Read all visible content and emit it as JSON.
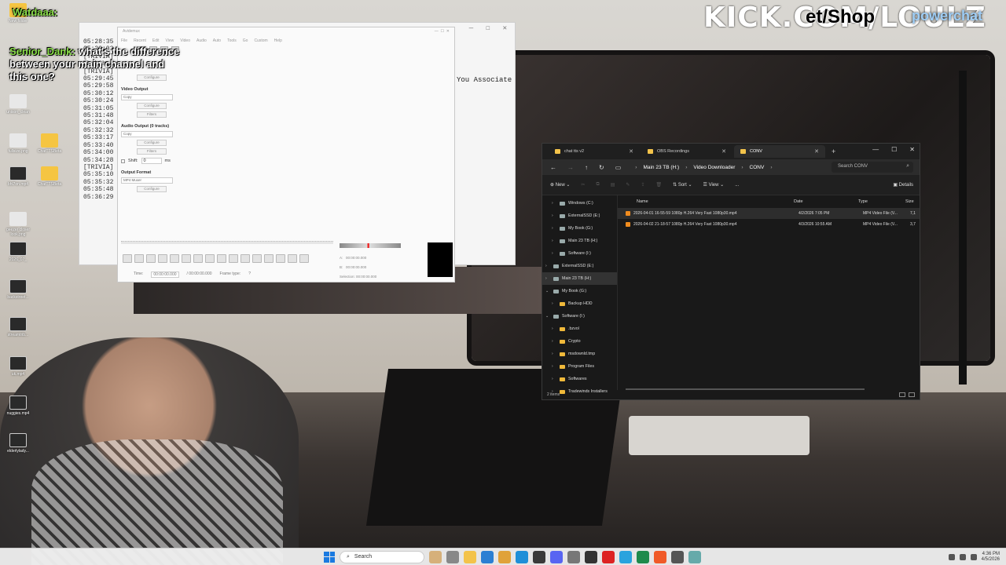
{
  "overlay": {
    "top_user": "Watdaaa:",
    "chat_user": "Senior_Dank:",
    "chat_message": "what's the difference between your main channel and this one?",
    "banner": "KICK.COM/LOULZ",
    "banner_tail": "et/Shop",
    "brand": "powerchat"
  },
  "desktop_icons": [
    {
      "label": "New folder",
      "kind": "folder"
    },
    {
      "label": "unison_clean",
      "kind": "file"
    },
    {
      "label": "fullsize.png",
      "kind": "file"
    },
    {
      "label": "ChatTTSBeta",
      "kind": "folder"
    },
    {
      "label": "bhl7on.mp4",
      "kind": "media"
    },
    {
      "label": "ChatTTSBeta",
      "kind": "folder"
    },
    {
      "label": "geezer closer look.png",
      "kind": "file"
    },
    {
      "label": "2026_07_",
      "kind": "media"
    },
    {
      "label": "backstreet...",
      "kind": "media"
    },
    {
      "label": "streamtrib...",
      "kind": "media"
    },
    {
      "label": "uk.mp4",
      "kind": "media"
    },
    {
      "label": "nuggies.mp4",
      "kind": "media"
    },
    {
      "label": "elderlylady...",
      "kind": "media"
    }
  ],
  "console": {
    "lines": [
      "05:28:35",
      "05:29:03",
      "[TRIVIA]",
      "The Charac",
      "[TRIVIA]",
      "05:29:45",
      "05:29:58",
      "05:30:12",
      "05:30:24",
      "05:31:05",
      "05:31:48",
      "05:32:04",
      "05:32:32",
      "05:33:17",
      "05:33:40",
      "05:34:00",
      "05:34:28",
      "[TRIVIA]",
      "05:35:10",
      "05:35:32",
      "05:35:48",
      "05:36:29"
    ],
    "right_text": "You Associate"
  },
  "avidemux": {
    "title": "Avidemux",
    "menu": [
      "File",
      "Recent",
      "Edit",
      "View",
      "Video",
      "Audio",
      "Auto",
      "Tools",
      "Go",
      "Custom",
      "Help"
    ],
    "video_output_label": "Video Output",
    "video_codec": "Copy",
    "audio_output_label": "Audio Output (0 tracks)",
    "audio_codec": "Copy",
    "shift_label": "Shift:",
    "shift_value": "0",
    "shift_unit": "ms",
    "output_format_label": "Output Format",
    "output_format": "MP4 Muxer",
    "configure_label": "Configure",
    "filters_label": "Filters",
    "time_label": "Time:",
    "time_value": "00:00:00.000",
    "time_total": "/ 00:00:00.000",
    "frame_type_label": "Frame type:",
    "frame_type_value": "?",
    "a_label": "A:",
    "a_value": "00:00:00.000",
    "b_label": "B:",
    "b_value": "00:00:00.000",
    "selection_label": "Selection: 00:00:00.000"
  },
  "explorer": {
    "tabs": [
      {
        "label": "chat tts v2"
      },
      {
        "label": "OBS Recordings"
      },
      {
        "label": "CONV"
      }
    ],
    "breadcrumb": [
      "Main 23 TB (H:)",
      "Video Downloader",
      "CONV"
    ],
    "search_placeholder": "Search CONV",
    "cmd": {
      "new": "New",
      "sort": "Sort",
      "view": "View",
      "more": "...",
      "details": "Details"
    },
    "tree": [
      {
        "label": "Windows (C:)",
        "kind": "drive",
        "indent": 1
      },
      {
        "label": "ExternalSSD (E:)",
        "kind": "drive",
        "indent": 1
      },
      {
        "label": "My Book (G:)",
        "kind": "drive",
        "indent": 1
      },
      {
        "label": "Main 23 TB (H:)",
        "kind": "drive",
        "indent": 1
      },
      {
        "label": "Software (I:)",
        "kind": "drive",
        "indent": 1
      },
      {
        "label": "ExternalSSD (E:)",
        "kind": "drive",
        "indent": 0
      },
      {
        "label": "Main 23 TB (H:)",
        "kind": "drive",
        "indent": 0,
        "selected": true
      },
      {
        "label": "My Book (G:)",
        "kind": "drive",
        "indent": 0,
        "expanded": true
      },
      {
        "label": "Backup HDD",
        "kind": "folder",
        "indent": 1
      },
      {
        "label": "Software (I:)",
        "kind": "drive",
        "indent": 0,
        "expanded": true
      },
      {
        "label": ".bzvol",
        "kind": "folder",
        "indent": 1
      },
      {
        "label": "Crypto",
        "kind": "folder",
        "indent": 1
      },
      {
        "label": "msdownld.tmp",
        "kind": "folder",
        "indent": 1
      },
      {
        "label": "Program Files",
        "kind": "folder",
        "indent": 1
      },
      {
        "label": "Softwares",
        "kind": "folder",
        "indent": 1
      },
      {
        "label": "Tradewinds Installers",
        "kind": "folder",
        "indent": 1
      }
    ],
    "columns": {
      "name": "Name",
      "date": "Date",
      "type": "Type",
      "size": "Size"
    },
    "files": [
      {
        "name": "2026-04-01 16-55-59 1080p H.264 Very Fast 1080p30.mp4",
        "date": "4/2/2026 7:05 PM",
        "type": "MP4 Video File (V...",
        "size": "7,1"
      },
      {
        "name": "2026-04-02 21-18-57 1080p H.264 Very Fast 1080p30.mp4",
        "date": "4/3/2026 10:55 AM",
        "type": "MP4 Video File (V...",
        "size": "3,7"
      }
    ],
    "status": "2 items"
  },
  "taskbar": {
    "search_label": "Search",
    "time": "4:36 PM",
    "date": "4/5/2026"
  }
}
